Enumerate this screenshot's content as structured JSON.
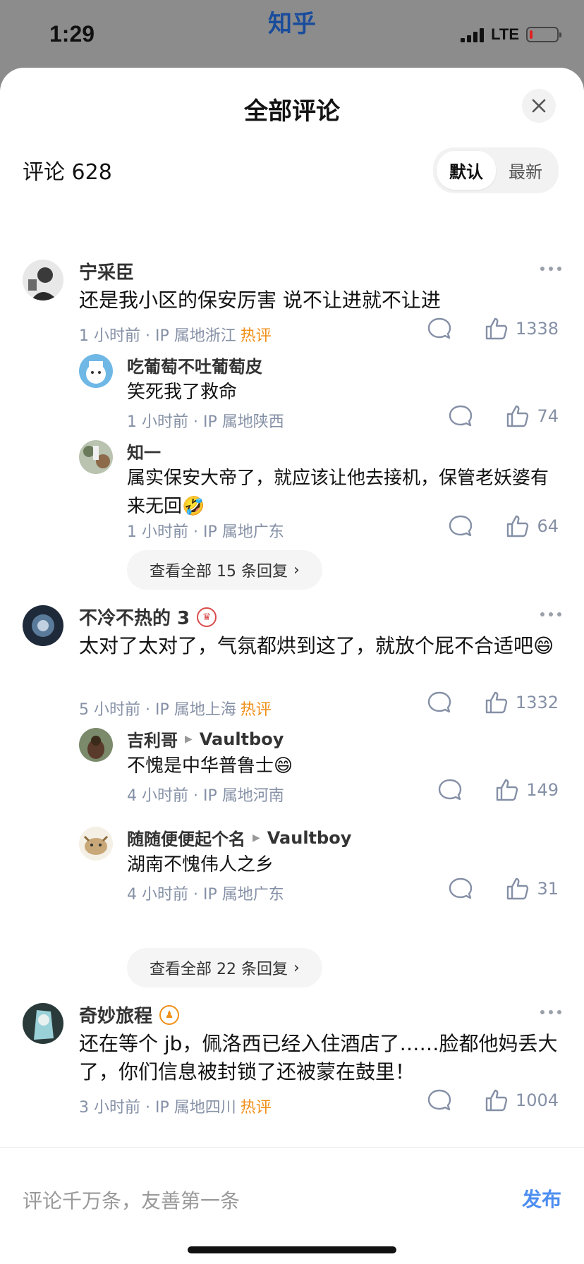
{
  "status_bar": {
    "time": "1:29",
    "app_brand": "知乎",
    "network": "LTE"
  },
  "sheet": {
    "title": "全部评论",
    "comment_count_label": "评论 628",
    "sort_options": [
      "默认",
      "最新"
    ],
    "sort_selected": "默认"
  },
  "comments": [
    {
      "author": "宁采臣",
      "text": "还是我小区的保安厉害 说不让进就不让进",
      "time": "1 小时前",
      "ip": "IP 属地浙江",
      "hot": "热评",
      "likes": "1338",
      "replies": [
        {
          "author": "吃葡萄不吐葡萄皮",
          "text": "笑死我了救命",
          "time": "1 小时前",
          "ip": "IP 属地陕西",
          "likes": "74"
        },
        {
          "author": "知一",
          "text": "属实保安大帝了，就应该让他去接机，保管老妖婆有来无回🤣",
          "time": "1 小时前",
          "ip": "IP 属地广东",
          "likes": "64"
        }
      ],
      "view_all": "查看全部 15 条回复"
    },
    {
      "author": "不冷不热的 3",
      "text": "太对了太对了，气氛都烘到这了，就放个屁不合适吧😄",
      "time": "5 小时前",
      "ip": "IP 属地上海",
      "hot": "热评",
      "likes": "1332",
      "replies": [
        {
          "author": "吉利哥",
          "reply_to": "Vaultboy",
          "text": "不愧是中华普鲁士😄",
          "time": "4 小时前",
          "ip": "IP 属地河南",
          "likes": "149"
        },
        {
          "author": "随随便便起个名",
          "reply_to": "Vaultboy",
          "text": "湖南不愧伟人之乡",
          "time": "4 小时前",
          "ip": "IP 属地广东",
          "likes": "31"
        }
      ],
      "view_all": "查看全部 22 条回复"
    },
    {
      "author": "奇妙旅程",
      "text": "还在等个 jb，佩洛西已经入住酒店了……脸都他妈丢大了，你们信息被封锁了还被蒙在鼓里！",
      "time": "3 小时前",
      "ip": "IP 属地四川",
      "hot": "热评",
      "likes": "1004"
    }
  ],
  "composer": {
    "placeholder": "评论千万条，友善第一条",
    "publish_label": "发布"
  },
  "colors": {
    "hot": "#f0901a",
    "publish": "#4d8ef0",
    "meta": "#8590a6"
  }
}
